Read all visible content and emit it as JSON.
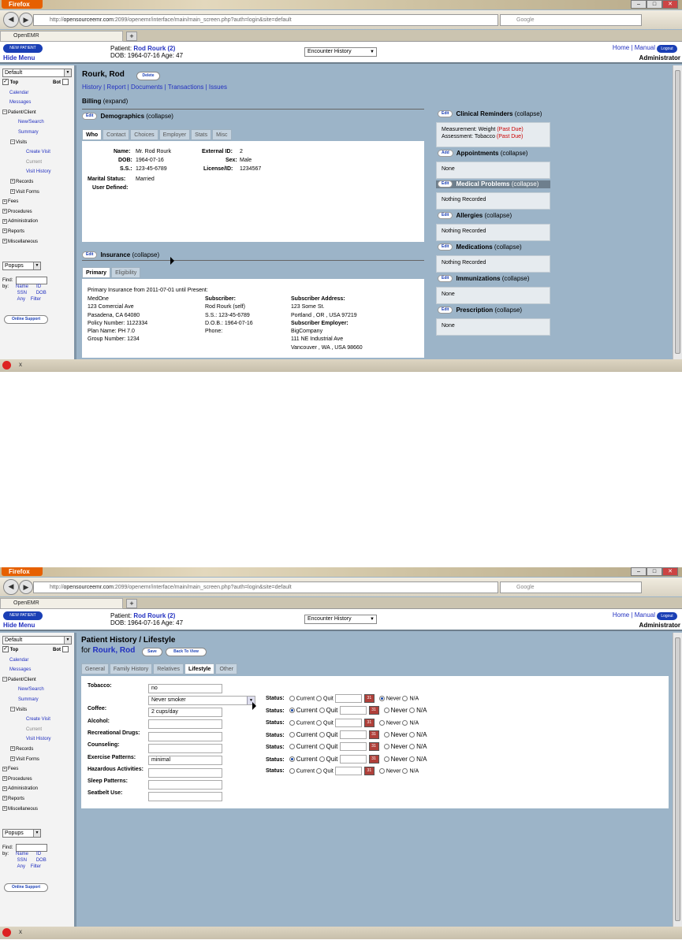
{
  "browser": {
    "menu": "Firefox",
    "url_host": "opensourceemr.com",
    "url_prefix": "http://",
    "url_rest": ":2099/openemr/interface/main/main_screen.php?auth=login&site=default",
    "search_placeholder": "Google",
    "tab_title": "OpenEMR",
    "new_tab": "+",
    "back": "◀",
    "fwd": "▶",
    "minimize": "–",
    "maximize": "□",
    "close": "✕",
    "status_close": "x"
  },
  "header": {
    "new_patient": "NEW PATIENT",
    "hide_menu": "Hide Menu",
    "patient_label": "Patient:",
    "patient_name": "Rod Rourk (2)",
    "dob_age": "DOB: 1964-07-16 Age: 47",
    "encounter_select": "Encounter History",
    "home": "Home",
    "manual": "Manual",
    "sep": "|",
    "logout": "Logout",
    "user": "Administrator"
  },
  "nav": {
    "view_select": "Default",
    "top_label": "Top",
    "bot_label": "Bot",
    "items": [
      "Calendar",
      "Messages",
      "Patient/Client",
      "New/Search",
      "Summary",
      "Visits",
      "Create Visit",
      "Current",
      "Visit History",
      "Records",
      "Visit Forms",
      "Fees",
      "Procedures",
      "Administration",
      "Reports",
      "Miscellaneous"
    ],
    "popups": "Popups",
    "find": "Find:",
    "by": "by:",
    "name": "Name",
    "id": "ID",
    "ssn": "SSN",
    "dob": "DOB",
    "any": "Any",
    "filter": "Filter",
    "online_support": "Online Support"
  },
  "screen1": {
    "patient": "Rourk, Rod",
    "delete": "Delete",
    "links": [
      "History",
      "Report",
      "Documents",
      "Transactions",
      "Issues"
    ],
    "billing": "Billing",
    "expand": "(expand)",
    "edit": "Edit",
    "add": "Add",
    "demographics": "Demographics",
    "collapse": "(collapse)",
    "demo_tabs": [
      "Who",
      "Contact",
      "Choices",
      "Employer",
      "Stats",
      "Misc"
    ],
    "who": {
      "name_l": "Name:",
      "name_v": "Mr. Rod Rourk",
      "dob_l": "DOB:",
      "dob_v": "1964-07-16",
      "ss_l": "S.S.:",
      "ss_v": "123-45-6789",
      "marital_l": "Marital Status:",
      "marital_v": "Married",
      "user_l": "User Defined:",
      "ext_l": "External ID:",
      "ext_v": "2",
      "sex_l": "Sex:",
      "sex_v": "Male",
      "lic_l": "License/ID:",
      "lic_v": "1234567"
    },
    "insurance": "Insurance",
    "ins_tabs": [
      "Primary",
      "Eligibility"
    ],
    "ins": {
      "primary_from": "Primary Insurance from 2011-07-01 until Present:",
      "company": "MedOne",
      "addr1": "123 Comercial Ave",
      "addr2": "Pasadena, CA 64080",
      "policy": "Policy Number: 1122334",
      "plan": "Plan Name: PH 7.0",
      "group": "Group Number: 1234",
      "subscriber_l": "Subscriber:",
      "subscriber_v": "Rod Rourk (self)",
      "sub_ss": "S.S.: 123-45-6789",
      "sub_dob": "D.O.B.: 1964-07-16",
      "phone": "Phone:",
      "sub_addr_l": "Subscriber Address:",
      "sub_addr1": "123 Some St.",
      "sub_addr2": "Portland , OR , USA 97219",
      "sub_emp_l": "Subscriber Employer:",
      "emp1": "BigCompany",
      "emp2": "111 NE Industrial Ave",
      "emp3": "Vancouver , WA , USA 98660"
    },
    "right": {
      "reminders": "Clinical Reminders",
      "rem1": "Measurement: Weight",
      "rem2": "Assessment: Tobacco",
      "past_due": "(Past Due)",
      "appointments": "Appointments",
      "appt_v": "None",
      "problems": "Medical Problems",
      "problems_v": "Nothing Recorded",
      "allergies": "Allergies",
      "allergies_v": "Nothing Recorded",
      "medications": "Medications",
      "medications_v": "Nothing Recorded",
      "immunizations": "Immunizations",
      "immunizations_v": "None",
      "prescription": "Prescription",
      "prescription_v": "None"
    }
  },
  "screen2": {
    "title": "Patient History / Lifestyle",
    "for": "for",
    "patient": "Rourk, Rod",
    "save": "Save",
    "back": "Back To View",
    "tabs": [
      "General",
      "Family History",
      "Relatives",
      "Lifestyle",
      "Other"
    ],
    "status": "Status:",
    "current": "Current",
    "quit": "Quit",
    "never": "Never",
    "na": "N/A",
    "rows": [
      {
        "label": "Tobacco:",
        "value": "no"
      },
      {
        "label": "Coffee:",
        "value": "2 cups/day"
      },
      {
        "label": "Alcohol:",
        "value": ""
      },
      {
        "label": "Recreational Drugs:",
        "value": ""
      },
      {
        "label": "Counseling:",
        "value": ""
      },
      {
        "label": "Exercise Patterns:",
        "value": "minimal"
      },
      {
        "label": "Hazardous Activities:",
        "value": ""
      },
      {
        "label": "Sleep Patterns:",
        "value": ""
      },
      {
        "label": "Seatbelt Use:",
        "value": ""
      }
    ],
    "tobacco_select": "Never smoker"
  },
  "colors": {
    "link": "#2230c0",
    "brand_button": "#1a3fb5",
    "past_due": "#cc0000",
    "app_bg": "#9cb4c8"
  }
}
